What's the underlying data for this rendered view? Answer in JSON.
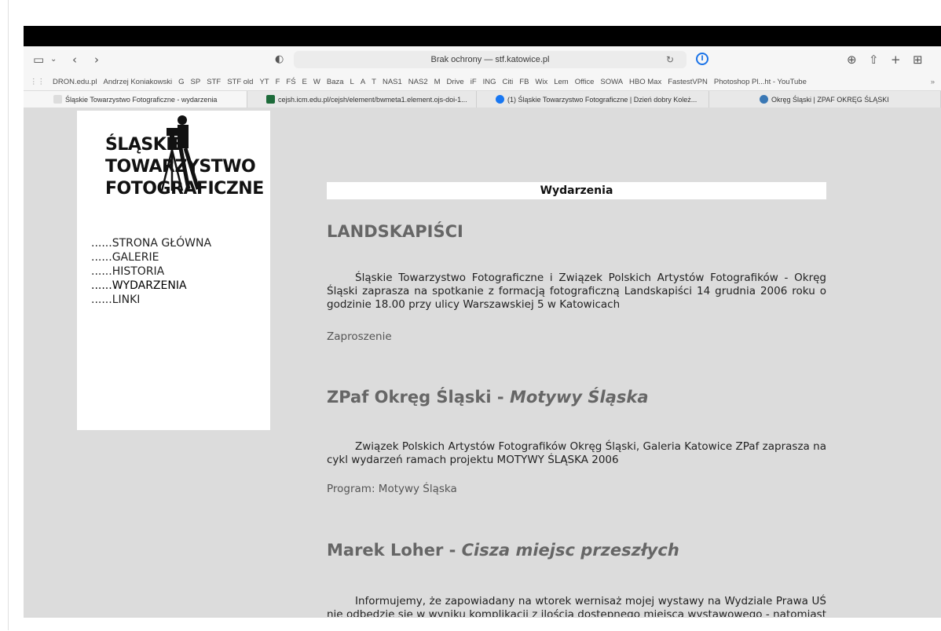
{
  "browser": {
    "address_text": "Brak ochrony — stf.katowice.pl",
    "icons": [
      "sidebar-icon",
      "chevron-down-icon",
      "back-icon",
      "forward-icon",
      "shield-icon",
      "reload-icon",
      "password-manager-icon",
      "download-icon",
      "share-icon",
      "new-tab-icon",
      "tab-overview-icon"
    ],
    "bookmarks": [
      "DRON.edu.pl",
      "Andrzej Koniakowski",
      "G",
      "SP",
      "STF",
      "STF old",
      "YT",
      "F",
      "FŚ",
      "E",
      "W",
      "Baza",
      "L",
      "A",
      "T",
      "NAS1",
      "NAS2",
      "M",
      "Drive",
      "iF",
      "ING",
      "Citi",
      "FB",
      "Wix",
      "Lem",
      "Office",
      "SOWA",
      "HBO Max",
      "FastestVPN",
      "Photoshop Pl...ht - YouTube"
    ],
    "tabs": [
      {
        "label": "Śląskie Towarzystwo Fotograficzne - wydarzenia",
        "active": true
      },
      {
        "label": "cejsh.icm.edu.pl/cejsh/element/bwmeta1.element.ojs-doi-1...",
        "active": false
      },
      {
        "label": "(1) Śląskie Towarzystwo Fotograficzne | Dzień dobry Koleż...",
        "active": false
      },
      {
        "label": "Okręg Śląski | ZPAF OKRĘG ŚLĄSKI",
        "active": false
      }
    ]
  },
  "logo": {
    "line1": "ŚLĄSKIE",
    "line2": "TOWARZYSTWO",
    "line3": "FOTOGRAFICZNE"
  },
  "nav": {
    "items": [
      {
        "label": "......STRONA GŁÓWNA"
      },
      {
        "label": "......GALERIE"
      },
      {
        "label": "......HISTORIA"
      },
      {
        "label": "......WYDARZENIA"
      },
      {
        "label": "......LINKI"
      }
    ]
  },
  "content": {
    "heading": "Wydarzenia",
    "sections": [
      {
        "title": "LANDSKAPIŚCI",
        "title_em": "",
        "paragraph": "Śląskie Towarzystwo Fotograficzne i Związek Polskich Artystów Fotografików - Okręg Śląski zaprasza na spotkanie z formacją fotograficzną Landskapiści 14 grudnia 2006 roku o godzinie 18.00 przy ulicy Warszawskiej 5 w Katowicach",
        "link": "Zaproszenie"
      },
      {
        "title": "ZPaf Okręg Śląski - ",
        "title_em": "Motywy Śląska",
        "paragraph": "Związek Polskich Artystów Fotografików Okręg Śląski, Galeria Katowice ZPaf zaprasza na cykl wydarzeń ramach projektu MOTYWY ŚLĄSKA 2006",
        "link": "Program: Motywy Śląska"
      },
      {
        "title": "Marek Loher - ",
        "title_em": "Cisza miejsc przeszłych",
        "paragraph": "Informujemy, że zapowiadany na wtorek wernisaż mojej wystawy na Wydziale Prawa UŚ nie odbędzie się w wyniku komplikacji z ilością dostępnego miejsca wystawowego - natomiast o",
        "link": ""
      }
    ]
  }
}
